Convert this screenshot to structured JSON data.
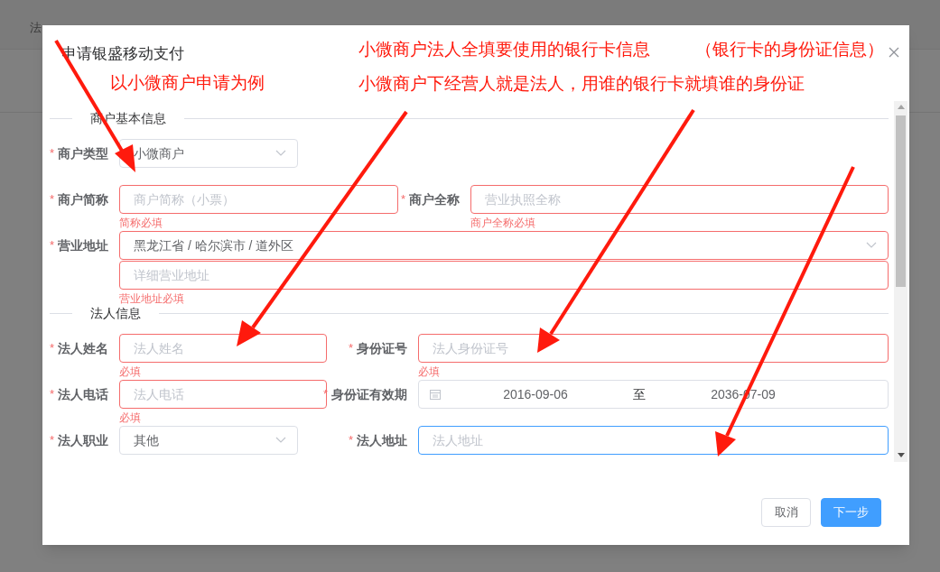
{
  "background_table": {
    "columns": [
      "法"
    ]
  },
  "dialog": {
    "title": "申请银盛移动支付",
    "sections": [
      {
        "title": "商户基本信息",
        "rows": [
          [
            {
              "kind": "select",
              "marker": "*",
              "label": "商户类型",
              "value": "小微商户",
              "invalid": false
            }
          ],
          [
            {
              "kind": "input",
              "marker": "*",
              "label": "商户简称",
              "placeholder": "商户简称（小票）",
              "invalid": true,
              "error": "简称必填"
            },
            {
              "kind": "input",
              "marker": "*",
              "label": "商户全称",
              "placeholder": "营业执照全称",
              "invalid": true,
              "error": "商户全称必填"
            }
          ],
          [
            {
              "kind": "address",
              "marker": "*",
              "label": "营业地址",
              "value": "黑龙江省 / 哈尔滨市 / 道外区",
              "placeholder": "详细营业地址",
              "invalid": true,
              "error": "营业地址必填"
            }
          ]
        ]
      },
      {
        "title": "法人信息",
        "rows": [
          [
            {
              "kind": "input",
              "marker": "*",
              "label": "法人姓名",
              "placeholder": "法人姓名",
              "invalid": true,
              "error": "必填"
            },
            {
              "kind": "input",
              "marker": "*",
              "label": "身份证号",
              "placeholder": "法人身份证号",
              "invalid": true,
              "error": "必填"
            }
          ],
          [
            {
              "kind": "input",
              "marker": "*",
              "label": "法人电话",
              "placeholder": "法人电话",
              "invalid": true,
              "error": "必填"
            },
            {
              "kind": "daterange",
              "marker": "*",
              "label": "身份证有效期",
              "start": "2016-09-06",
              "separator": "至",
              "end": "2036-07-09",
              "invalid": false
            }
          ],
          [
            {
              "kind": "select",
              "marker": "*",
              "label": "法人职业",
              "value": "其他",
              "invalid": false
            },
            {
              "kind": "input",
              "marker": "*",
              "label": "法人地址",
              "placeholder": "法人地址",
              "invalid": false,
              "focused": true
            }
          ]
        ]
      }
    ],
    "buttons": [
      {
        "label": "取消",
        "kind": "default"
      },
      {
        "label": "下一步",
        "kind": "primary"
      }
    ]
  },
  "annotations": [
    {
      "text": "小微商户法人全填要使用的银行卡信息"
    },
    {
      "text": "（银行卡的身份证信息）"
    },
    {
      "text": "以小微商户申请为例"
    },
    {
      "text": "小微商户下经营人就是法人，用谁的银行卡就填谁的身份证"
    }
  ]
}
